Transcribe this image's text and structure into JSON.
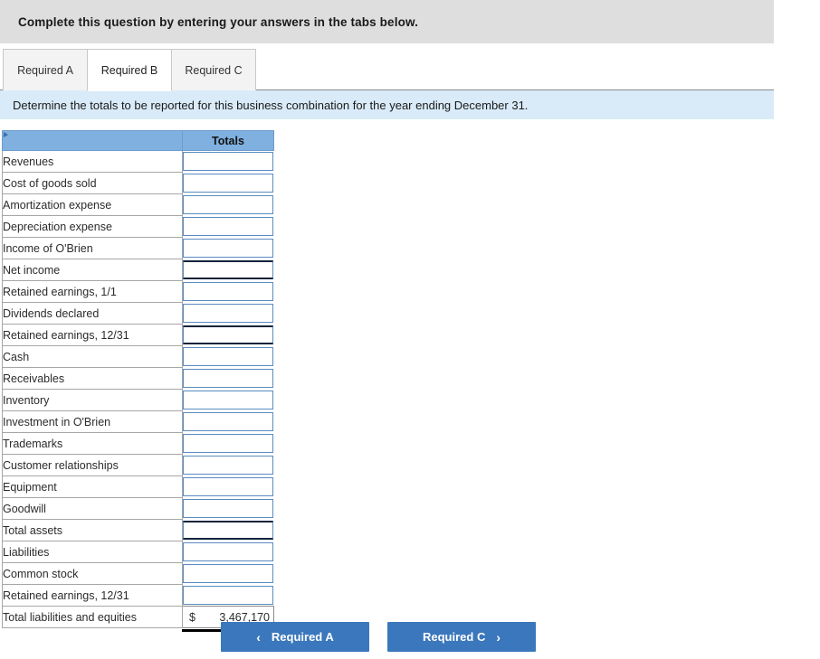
{
  "question": {
    "prompt": "Complete this question by entering your answers in the tabs below."
  },
  "tabs": [
    {
      "label": "Required A",
      "active": false
    },
    {
      "label": "Required B",
      "active": true
    },
    {
      "label": "Required C",
      "active": false
    }
  ],
  "requirement": {
    "text": "Determine the totals to be reported for this business combination for the year ending December 31."
  },
  "table": {
    "header": {
      "label_col": "",
      "value_col": "Totals"
    },
    "rows": [
      {
        "label": "Revenues",
        "indent": false,
        "type": "input",
        "value": "",
        "rule_top": false,
        "rule_bottom": false
      },
      {
        "label": "Cost of goods sold",
        "indent": false,
        "type": "input",
        "value": "",
        "rule_top": false,
        "rule_bottom": false
      },
      {
        "label": "Amortization expense",
        "indent": false,
        "type": "input",
        "value": "",
        "rule_top": false,
        "rule_bottom": false
      },
      {
        "label": "Depreciation expense",
        "indent": false,
        "type": "input",
        "value": "",
        "rule_top": false,
        "rule_bottom": false
      },
      {
        "label": "Income of O'Brien",
        "indent": false,
        "type": "input",
        "value": "",
        "rule_top": false,
        "rule_bottom": false
      },
      {
        "label": "Net income",
        "indent": true,
        "type": "input",
        "value": "",
        "rule_top": true,
        "rule_bottom": true
      },
      {
        "label": "Retained earnings, 1/1",
        "indent": false,
        "type": "input",
        "value": "",
        "rule_top": false,
        "rule_bottom": false
      },
      {
        "label": "Dividends declared",
        "indent": false,
        "type": "input",
        "value": "",
        "rule_top": false,
        "rule_bottom": false
      },
      {
        "label": "Retained earnings, 12/31",
        "indent": true,
        "type": "input",
        "value": "",
        "rule_top": true,
        "rule_bottom": true
      },
      {
        "label": "Cash",
        "indent": false,
        "type": "input",
        "value": "",
        "rule_top": false,
        "rule_bottom": false
      },
      {
        "label": "Receivables",
        "indent": false,
        "type": "input",
        "value": "",
        "rule_top": false,
        "rule_bottom": false
      },
      {
        "label": "Inventory",
        "indent": false,
        "type": "input",
        "value": "",
        "rule_top": false,
        "rule_bottom": false
      },
      {
        "label": "Investment in O'Brien",
        "indent": false,
        "type": "input",
        "value": "",
        "rule_top": false,
        "rule_bottom": false
      },
      {
        "label": "Trademarks",
        "indent": false,
        "type": "input",
        "value": "",
        "rule_top": false,
        "rule_bottom": false
      },
      {
        "label": "Customer relationships",
        "indent": false,
        "type": "input",
        "value": "",
        "rule_top": false,
        "rule_bottom": false
      },
      {
        "label": "Equipment",
        "indent": false,
        "type": "input",
        "value": "",
        "rule_top": false,
        "rule_bottom": false
      },
      {
        "label": "Goodwill",
        "indent": false,
        "type": "input",
        "value": "",
        "rule_top": false,
        "rule_bottom": false
      },
      {
        "label": "Total assets",
        "indent": true,
        "type": "input",
        "value": "",
        "rule_top": true,
        "rule_bottom": true
      },
      {
        "label": "Liabilities",
        "indent": false,
        "type": "input",
        "value": "",
        "rule_top": false,
        "rule_bottom": false
      },
      {
        "label": "Common stock",
        "indent": false,
        "type": "input",
        "value": "",
        "rule_top": false,
        "rule_bottom": false
      },
      {
        "label": "Retained earnings, 12/31",
        "indent": false,
        "type": "input",
        "value": "",
        "rule_top": false,
        "rule_bottom": false
      },
      {
        "label": "Total liabilities and equities",
        "indent": true,
        "type": "total",
        "value": "3,467,170",
        "currency": "$",
        "rule_top": false,
        "rule_bottom": true
      }
    ]
  },
  "footer": {
    "prev_label": "Required A",
    "next_label": "Required C",
    "prev_chevron": "‹",
    "next_chevron": "›"
  },
  "colors": {
    "header_bar": "#dedede",
    "banner": "#d9ebf8",
    "sheet_header": "#7fb0e0",
    "input_border": "#5a8cc0",
    "button": "#3b77bc"
  }
}
